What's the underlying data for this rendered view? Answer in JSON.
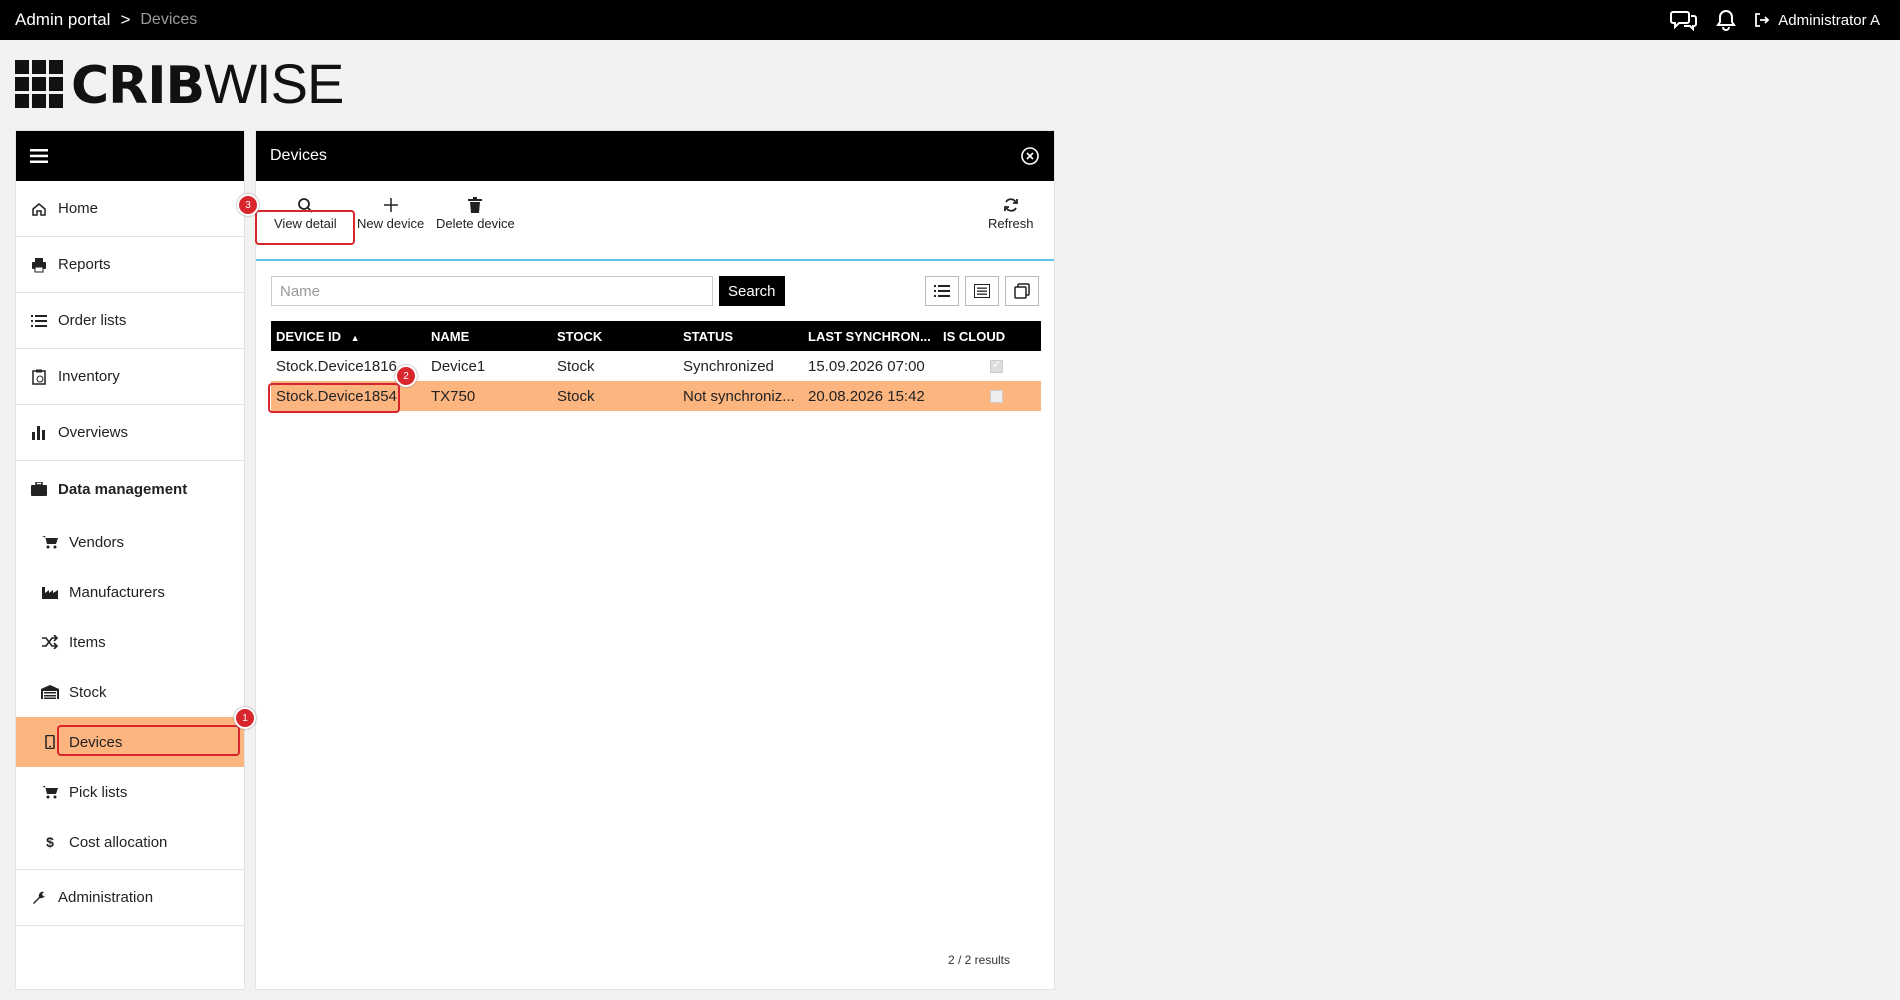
{
  "topbar": {
    "crumb_root": "Admin portal",
    "crumb_sep": ">",
    "crumb_current": "Devices",
    "user": "Administrator A",
    "icons": [
      "chat-icon",
      "bell-icon",
      "logout-icon"
    ]
  },
  "logo": {
    "part1": "CRIB",
    "part2": "WISE"
  },
  "sidebar": {
    "items": [
      {
        "label": "Home",
        "icon": "home-icon"
      },
      {
        "label": "Reports",
        "icon": "printer-icon"
      },
      {
        "label": "Order lists",
        "icon": "list-icon"
      },
      {
        "label": "Inventory",
        "icon": "clipboard-icon"
      },
      {
        "label": "Overviews",
        "icon": "bar-chart-icon"
      },
      {
        "label": "Data management",
        "icon": "briefcase-icon"
      }
    ],
    "subitems": [
      {
        "label": "Vendors",
        "icon": "cart-icon"
      },
      {
        "label": "Manufacturers",
        "icon": "factory-icon"
      },
      {
        "label": "Items",
        "icon": "shuffle-icon"
      },
      {
        "label": "Stock",
        "icon": "warehouse-icon"
      },
      {
        "label": "Devices",
        "icon": "mobile-icon",
        "active": true
      },
      {
        "label": "Pick lists",
        "icon": "cart-icon"
      },
      {
        "label": "Cost allocation",
        "icon": "dollar-icon"
      }
    ],
    "admin": {
      "label": "Administration",
      "icon": "wrench-icon"
    }
  },
  "panel": {
    "title": "Devices",
    "toolbar": {
      "view_detail": "View detail",
      "new_device": "New device",
      "delete_device": "Delete device",
      "refresh": "Refresh"
    },
    "search": {
      "placeholder": "Name",
      "button": "Search"
    },
    "table": {
      "columns": [
        "DEVICE ID",
        "NAME",
        "STOCK",
        "STATUS",
        "LAST SYNCHRON...",
        "IS CLOUD"
      ],
      "sort": {
        "column": "DEVICE ID",
        "direction": "asc"
      },
      "rows": [
        {
          "device_id": "Stock.Device1816",
          "name": "Device1",
          "stock": "Stock",
          "status": "Synchronized",
          "last_sync": "15.09.2026 07:00",
          "is_cloud": true
        },
        {
          "device_id": "Stock.Device1854",
          "name": "TX750",
          "stock": "Stock",
          "status": "Not synchroniz...",
          "last_sync": "20.08.2026 15:42",
          "is_cloud": false,
          "selected": true
        }
      ]
    },
    "results": "2 / 2 results"
  },
  "annotations": {
    "badge1": "1",
    "badge2": "2",
    "badge3": "3",
    "color": "#d9262c"
  },
  "colors": {
    "accent": "#fdb580",
    "divider": "#5bc0ea"
  }
}
